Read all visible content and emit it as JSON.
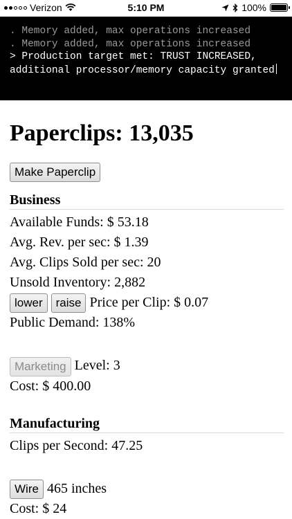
{
  "status_bar": {
    "carrier": "Verizon",
    "time": "5:10 PM",
    "battery": "100%",
    "battery_level": 1.0
  },
  "console": {
    "lines_old": [
      ". Memory added, max operations increased",
      ". Memory added, max operations increased"
    ],
    "line_new": "> Production target met: TRUST INCREASED, additional processor/memory capacity granted"
  },
  "clips": {
    "label": "Paperclips: 13,035",
    "make_button": "Make Paperclip"
  },
  "business": {
    "title": "Business",
    "funds": "Available Funds: $ 53.18",
    "rev": "Avg. Rev. per sec: $ 1.39",
    "sold": "Avg. Clips Sold per sec: 20",
    "inventory": "Unsold Inventory: 2,882",
    "lower_button": "lower",
    "raise_button": "raise",
    "price": "Price per Clip: $ 0.07",
    "demand": "Public Demand: 138%",
    "marketing_button": "Marketing",
    "marketing_level": "Level: 3",
    "marketing_cost": "Cost: $ 400.00"
  },
  "manufacturing": {
    "title": "Manufacturing",
    "clips_per_sec": "Clips per Second: 47.25",
    "wire_button": "Wire",
    "wire_amount": "465 inches",
    "wire_cost": "Cost: $ 24"
  }
}
